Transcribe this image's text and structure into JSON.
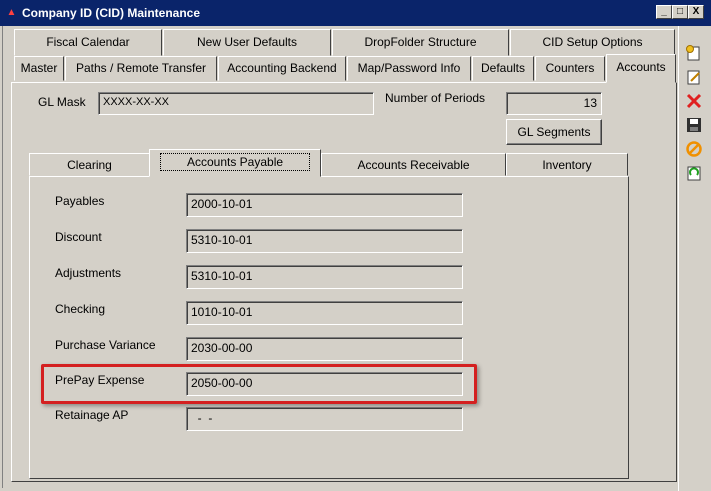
{
  "window": {
    "title": "Company ID (CID) Maintenance",
    "app_icon": "app-logo-icon",
    "buttons": {
      "minimize": "_",
      "maximize": "□",
      "close": "X"
    }
  },
  "tabs_top_row": [
    "Fiscal Calendar",
    "New User Defaults",
    "DropFolder Structure",
    "CID Setup Options"
  ],
  "tabs_bottom_row": [
    "Master",
    "Paths / Remote Transfer",
    "Accounting Backend",
    "Map/Password Info",
    "Defaults",
    "Counters",
    "Accounts"
  ],
  "selected_main_tab": "Accounts",
  "accounts": {
    "gl_mask_label": "GL Mask",
    "gl_mask_value": "XXXX-XX-XX",
    "periods_label": "Number of Periods",
    "periods_value": "13",
    "gl_segments_button": "GL Segments"
  },
  "sub_tabs": [
    "Clearing",
    "Accounts Payable",
    "Accounts Receivable",
    "Inventory"
  ],
  "selected_sub_tab": "Accounts Payable",
  "ap_fields": [
    {
      "label": "Payables",
      "value": "2000-10-01"
    },
    {
      "label": "Discount",
      "value": "5310-10-01"
    },
    {
      "label": "Adjustments",
      "value": "5310-10-01"
    },
    {
      "label": "Checking",
      "value": "1010-10-01"
    },
    {
      "label": "Purchase Variance",
      "value": "2030-00-00"
    },
    {
      "label": "PrePay Expense",
      "value": "2050-00-00"
    },
    {
      "label": "Retainage AP",
      "value": "  -  -"
    }
  ],
  "highlight_color": "#d42020",
  "toolbar_icons": [
    "new-record-icon",
    "edit-icon",
    "delete-icon",
    "save-icon",
    "cancel-icon",
    "refresh-icon"
  ]
}
